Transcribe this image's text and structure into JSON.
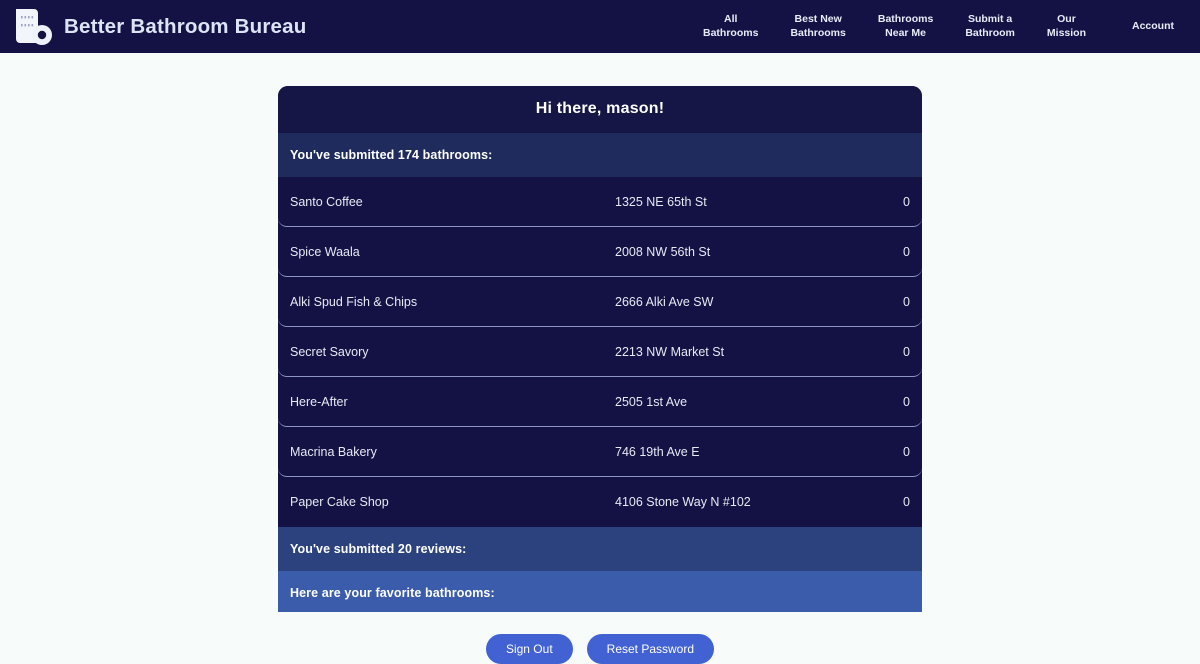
{
  "navbar": {
    "brand_name": "Better Bathroom Bureau",
    "logo_icon": "toilet-paper-roll-icon",
    "background_color": "#141244",
    "links": [
      {
        "label": "All\nBathrooms"
      },
      {
        "label": "Best New\nBathrooms"
      },
      {
        "label": "Bathrooms\nNear Me"
      },
      {
        "label": "Submit a\nBathroom"
      },
      {
        "label": "Our\nMission"
      },
      {
        "label": "Account"
      }
    ]
  },
  "card": {
    "greeting": "Hi there, mason!",
    "submitted_bathrooms_label": "You've submitted 174 bathrooms:",
    "submitted_reviews_label": "You've submitted 20 reviews:",
    "favorites_label": "Here are your favorite bathrooms:",
    "bathrooms": [
      {
        "name": "Santo Coffee",
        "address": "1325 NE 65th St",
        "count": "0"
      },
      {
        "name": "Spice Waala",
        "address": "2008 NW 56th St",
        "count": "0"
      },
      {
        "name": "Alki Spud Fish & Chips",
        "address": "2666 Alki Ave SW",
        "count": "0"
      },
      {
        "name": "Secret Savory",
        "address": "2213 NW Market St",
        "count": "0"
      },
      {
        "name": "Here-After",
        "address": "2505 1st Ave",
        "count": "0"
      },
      {
        "name": "Macrina Bakery",
        "address": "746 19th Ave E",
        "count": "0"
      },
      {
        "name": "Paper Cake Shop",
        "address": "4106 Stone Way N #102",
        "count": "0"
      }
    ]
  },
  "actions": {
    "sign_out_label": "Sign Out",
    "reset_password_label": "Reset Password"
  },
  "colors": {
    "page_background": "#f7fcfa",
    "navy_dark": "#141244",
    "card_header": "#151546",
    "band_submitted": "#1e2b5c",
    "band_reviews": "#2b427f",
    "band_favorites": "#3b5bab",
    "button_blue": "#4262d4",
    "row_divider": "#8e95c4"
  }
}
